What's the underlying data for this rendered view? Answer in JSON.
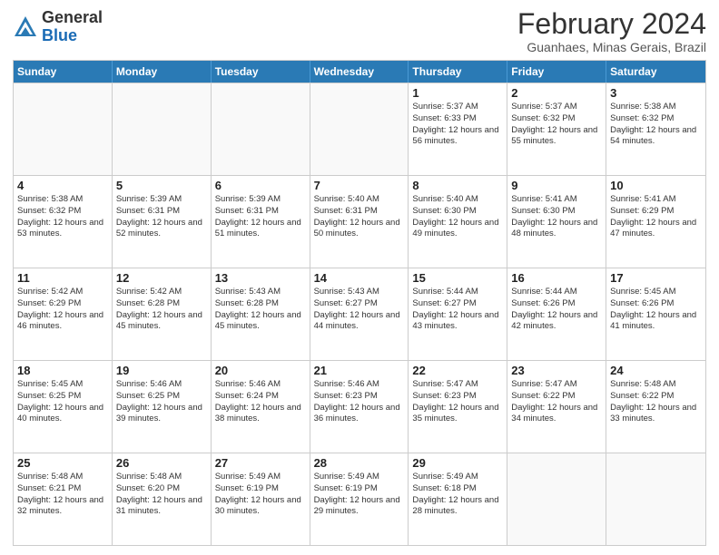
{
  "header": {
    "logo": {
      "line1": "General",
      "line2": "Blue"
    },
    "title": "February 2024",
    "location": "Guanhaes, Minas Gerais, Brazil"
  },
  "days_of_week": [
    "Sunday",
    "Monday",
    "Tuesday",
    "Wednesday",
    "Thursday",
    "Friday",
    "Saturday"
  ],
  "weeks": [
    [
      {
        "day": "",
        "info": ""
      },
      {
        "day": "",
        "info": ""
      },
      {
        "day": "",
        "info": ""
      },
      {
        "day": "",
        "info": ""
      },
      {
        "day": "1",
        "info": "Sunrise: 5:37 AM\nSunset: 6:33 PM\nDaylight: 12 hours\nand 56 minutes."
      },
      {
        "day": "2",
        "info": "Sunrise: 5:37 AM\nSunset: 6:32 PM\nDaylight: 12 hours\nand 55 minutes."
      },
      {
        "day": "3",
        "info": "Sunrise: 5:38 AM\nSunset: 6:32 PM\nDaylight: 12 hours\nand 54 minutes."
      }
    ],
    [
      {
        "day": "4",
        "info": "Sunrise: 5:38 AM\nSunset: 6:32 PM\nDaylight: 12 hours\nand 53 minutes."
      },
      {
        "day": "5",
        "info": "Sunrise: 5:39 AM\nSunset: 6:31 PM\nDaylight: 12 hours\nand 52 minutes."
      },
      {
        "day": "6",
        "info": "Sunrise: 5:39 AM\nSunset: 6:31 PM\nDaylight: 12 hours\nand 51 minutes."
      },
      {
        "day": "7",
        "info": "Sunrise: 5:40 AM\nSunset: 6:31 PM\nDaylight: 12 hours\nand 50 minutes."
      },
      {
        "day": "8",
        "info": "Sunrise: 5:40 AM\nSunset: 6:30 PM\nDaylight: 12 hours\nand 49 minutes."
      },
      {
        "day": "9",
        "info": "Sunrise: 5:41 AM\nSunset: 6:30 PM\nDaylight: 12 hours\nand 48 minutes."
      },
      {
        "day": "10",
        "info": "Sunrise: 5:41 AM\nSunset: 6:29 PM\nDaylight: 12 hours\nand 47 minutes."
      }
    ],
    [
      {
        "day": "11",
        "info": "Sunrise: 5:42 AM\nSunset: 6:29 PM\nDaylight: 12 hours\nand 46 minutes."
      },
      {
        "day": "12",
        "info": "Sunrise: 5:42 AM\nSunset: 6:28 PM\nDaylight: 12 hours\nand 45 minutes."
      },
      {
        "day": "13",
        "info": "Sunrise: 5:43 AM\nSunset: 6:28 PM\nDaylight: 12 hours\nand 45 minutes."
      },
      {
        "day": "14",
        "info": "Sunrise: 5:43 AM\nSunset: 6:27 PM\nDaylight: 12 hours\nand 44 minutes."
      },
      {
        "day": "15",
        "info": "Sunrise: 5:44 AM\nSunset: 6:27 PM\nDaylight: 12 hours\nand 43 minutes."
      },
      {
        "day": "16",
        "info": "Sunrise: 5:44 AM\nSunset: 6:26 PM\nDaylight: 12 hours\nand 42 minutes."
      },
      {
        "day": "17",
        "info": "Sunrise: 5:45 AM\nSunset: 6:26 PM\nDaylight: 12 hours\nand 41 minutes."
      }
    ],
    [
      {
        "day": "18",
        "info": "Sunrise: 5:45 AM\nSunset: 6:25 PM\nDaylight: 12 hours\nand 40 minutes."
      },
      {
        "day": "19",
        "info": "Sunrise: 5:46 AM\nSunset: 6:25 PM\nDaylight: 12 hours\nand 39 minutes."
      },
      {
        "day": "20",
        "info": "Sunrise: 5:46 AM\nSunset: 6:24 PM\nDaylight: 12 hours\nand 38 minutes."
      },
      {
        "day": "21",
        "info": "Sunrise: 5:46 AM\nSunset: 6:23 PM\nDaylight: 12 hours\nand 36 minutes."
      },
      {
        "day": "22",
        "info": "Sunrise: 5:47 AM\nSunset: 6:23 PM\nDaylight: 12 hours\nand 35 minutes."
      },
      {
        "day": "23",
        "info": "Sunrise: 5:47 AM\nSunset: 6:22 PM\nDaylight: 12 hours\nand 34 minutes."
      },
      {
        "day": "24",
        "info": "Sunrise: 5:48 AM\nSunset: 6:22 PM\nDaylight: 12 hours\nand 33 minutes."
      }
    ],
    [
      {
        "day": "25",
        "info": "Sunrise: 5:48 AM\nSunset: 6:21 PM\nDaylight: 12 hours\nand 32 minutes."
      },
      {
        "day": "26",
        "info": "Sunrise: 5:48 AM\nSunset: 6:20 PM\nDaylight: 12 hours\nand 31 minutes."
      },
      {
        "day": "27",
        "info": "Sunrise: 5:49 AM\nSunset: 6:19 PM\nDaylight: 12 hours\nand 30 minutes."
      },
      {
        "day": "28",
        "info": "Sunrise: 5:49 AM\nSunset: 6:19 PM\nDaylight: 12 hours\nand 29 minutes."
      },
      {
        "day": "29",
        "info": "Sunrise: 5:49 AM\nSunset: 6:18 PM\nDaylight: 12 hours\nand 28 minutes."
      },
      {
        "day": "",
        "info": ""
      },
      {
        "day": "",
        "info": ""
      }
    ]
  ]
}
